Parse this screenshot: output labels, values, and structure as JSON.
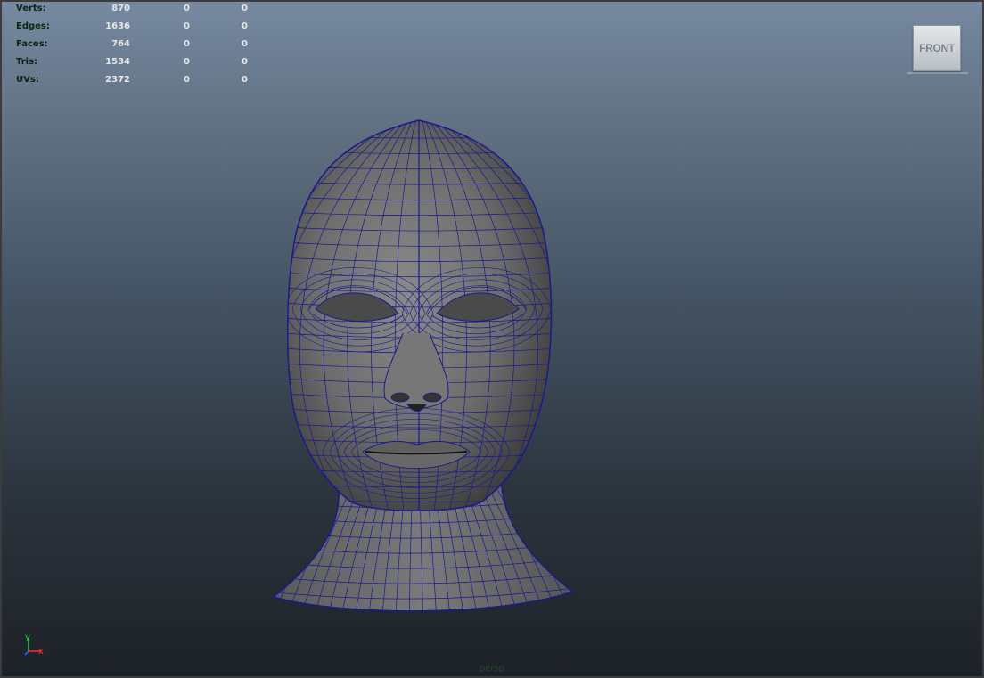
{
  "hud": {
    "rows": [
      {
        "label": "Verts:",
        "c1": "870",
        "c2": "0",
        "c3": "0"
      },
      {
        "label": "Edges:",
        "c1": "1636",
        "c2": "0",
        "c3": "0"
      },
      {
        "label": "Faces:",
        "c1": "764",
        "c2": "0",
        "c3": "0"
      },
      {
        "label": "Tris:",
        "c1": "1534",
        "c2": "0",
        "c3": "0"
      },
      {
        "label": "UVs:",
        "c1": "2372",
        "c2": "0",
        "c3": "0"
      }
    ]
  },
  "viewcube": {
    "face_label": "FRONT"
  },
  "axis": {
    "y_label": "y",
    "x_label": "x",
    "y_color": "#2ecc40",
    "x_color": "#ff3030"
  },
  "camera": {
    "label": "persp"
  },
  "mesh": {
    "wire_color": "#1a1a8c",
    "surface_color": "#6e6e6e"
  }
}
